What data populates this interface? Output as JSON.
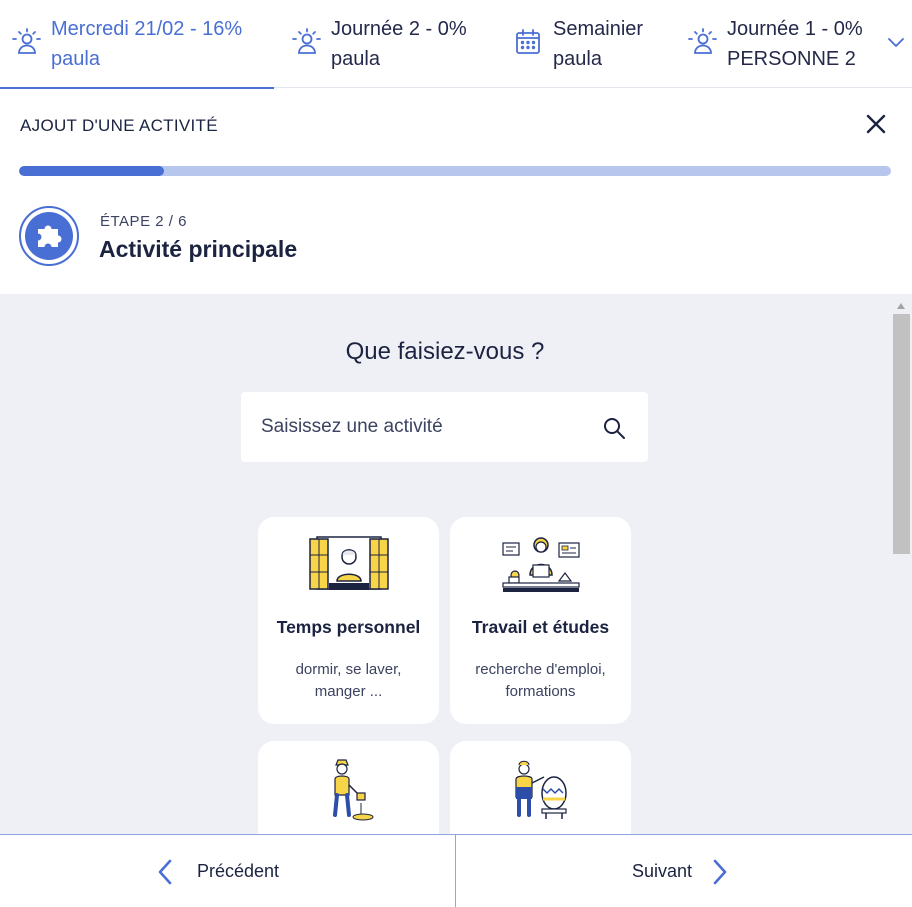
{
  "tabs": [
    {
      "line1": "Mercredi 21/02 - 16%",
      "line2": "paula",
      "icon": "person-sun-icon",
      "active": true
    },
    {
      "line1": "Journée 2 - 0%",
      "line2": "paula",
      "icon": "person-sun-icon",
      "active": false
    },
    {
      "line1": "Semainier",
      "line2": "paula",
      "icon": "calendar-icon",
      "active": false
    },
    {
      "line1": "Journée 1 - 0%",
      "line2": "PERSONNE 2",
      "icon": "person-sun-icon",
      "active": false
    }
  ],
  "header": {
    "title": "AJOUT D'UNE ACTIVITÉ",
    "progress": 0.166
  },
  "step": {
    "label": "ÉTAPE 2 / 6",
    "title": "Activité principale",
    "icon": "puzzle-icon"
  },
  "main": {
    "question": "Que faisiez-vous ?",
    "search_placeholder": "Saisissez une activité"
  },
  "cards": [
    {
      "title": "Temps personnel",
      "desc1": "dormir, se laver,",
      "desc2": "manger ..."
    },
    {
      "title": "Travail et études",
      "desc1": "recherche d'emploi,",
      "desc2": "formations"
    }
  ],
  "footer": {
    "prev_label": "Précédent",
    "next_label": "Suivant"
  },
  "colors": {
    "accent": "#4a6fd4",
    "progress_track": "#b7c6ec",
    "text": "#1b2341",
    "main_bg": "#efeff6",
    "illustration_yellow": "#f8d548"
  }
}
